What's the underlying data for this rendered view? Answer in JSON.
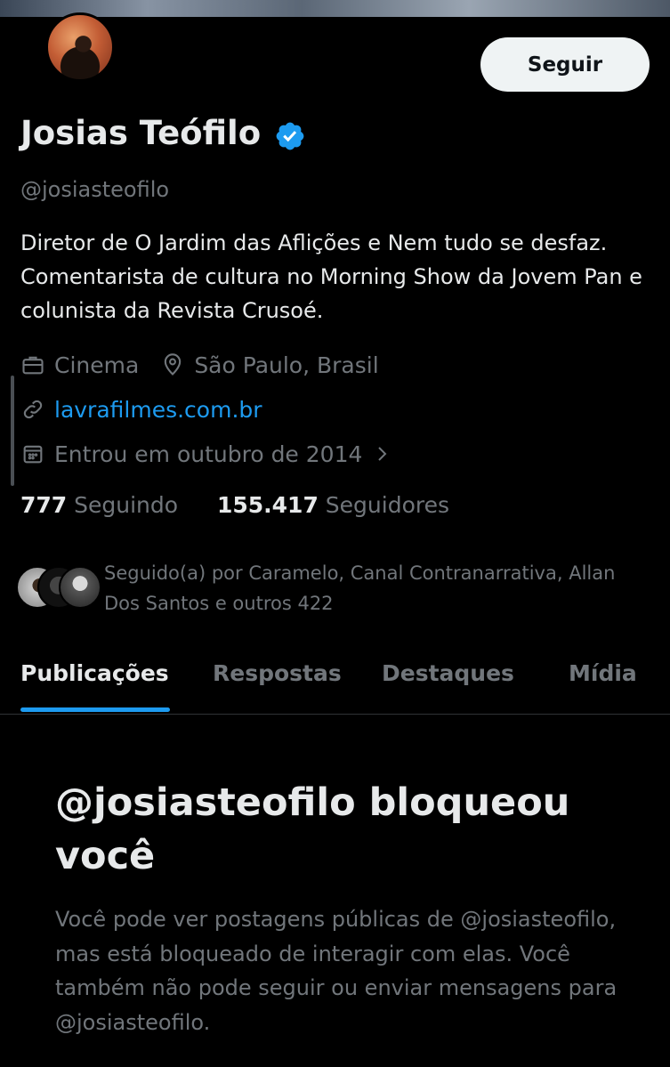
{
  "profile": {
    "name": "Josias Teófilo",
    "handle": "@josiasteofilo",
    "bio": "Diretor de O Jardim das Aflições e Nem tudo se desfaz. Comentarista de cultura no Morning Show da Jovem Pan e colunista da Revista Crusoé.",
    "category": "Cinema",
    "location": "São Paulo, Brasil",
    "website": "lavrafilmes.com.br",
    "joined": "Entrou em outubro de 2014",
    "follow_label": "Seguir"
  },
  "stats": {
    "following_count": "777",
    "following_label": "Seguindo",
    "followers_count": "155.417",
    "followers_label": "Seguidores"
  },
  "followed_by": "Seguido(a) por Caramelo, Canal Contranarrativa, Allan Dos Santos e outros 422",
  "tabs": [
    {
      "label": "Publicações",
      "active": true
    },
    {
      "label": "Respostas",
      "active": false
    },
    {
      "label": "Destaques",
      "active": false
    },
    {
      "label": "Mídia",
      "active": false
    }
  ],
  "blocked": {
    "title": "@josiasteofilo bloqueou você",
    "description": "Você pode ver postagens públicas de @josiasteofilo, mas está bloqueado de interagir com elas. Você também não pode seguir ou enviar mensagens para @josiasteofilo."
  },
  "colors": {
    "background": "#000000",
    "accent": "#1d9bf0",
    "muted": "#71767b",
    "text": "#e7e9ea"
  },
  "icons": [
    "briefcase-icon",
    "location-pin-icon",
    "link-icon",
    "calendar-icon",
    "chevron-right-icon",
    "verified-badge-icon"
  ]
}
